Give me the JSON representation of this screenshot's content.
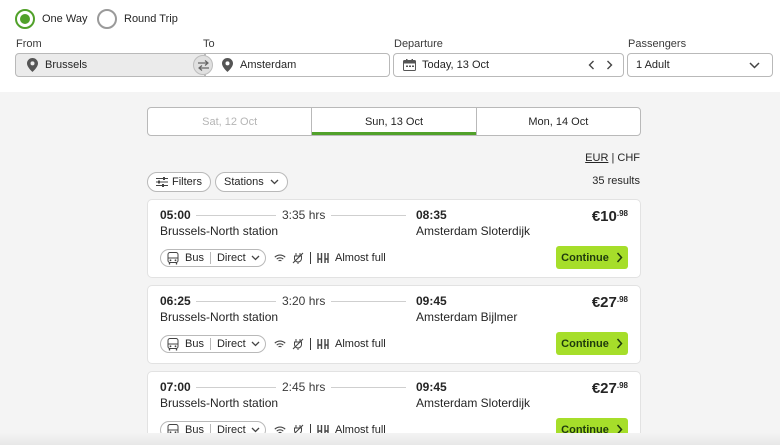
{
  "trip_type": {
    "one_way": "One Way",
    "round_trip": "Round Trip"
  },
  "search": {
    "from_label": "From",
    "from_value": "Brussels",
    "to_label": "To",
    "to_value": "Amsterdam",
    "departure_label": "Departure",
    "departure_value": "Today, 13 Oct",
    "passengers_label": "Passengers",
    "passengers_value": "1 Adult"
  },
  "dates": [
    "Sat, 12 Oct",
    "Sun, 13 Oct",
    "Mon, 14 Oct"
  ],
  "selected_date_index": 1,
  "currency": {
    "eur": "EUR",
    "separator": "|",
    "chf": "CHF"
  },
  "filters": {
    "filters_label": "Filters",
    "stations_label": "Stations"
  },
  "results_count": "35 results",
  "connections": [
    {
      "dep_time": "05:00",
      "duration": "3:35 hrs",
      "arr_time": "08:35",
      "from_station": "Brussels-North station",
      "to_station": "Amsterdam Sloterdijk",
      "price_main": "€10",
      "price_cents": ".98",
      "mode": "Bus",
      "route": "Direct",
      "capacity": "Almost full",
      "cta": "Continue"
    },
    {
      "dep_time": "06:25",
      "duration": "3:20 hrs",
      "arr_time": "09:45",
      "from_station": "Brussels-North station",
      "to_station": "Amsterdam Bijlmer",
      "price_main": "€27",
      "price_cents": ".98",
      "mode": "Bus",
      "route": "Direct",
      "capacity": "Almost full",
      "cta": "Continue"
    },
    {
      "dep_time": "07:00",
      "duration": "2:45 hrs",
      "arr_time": "09:45",
      "from_station": "Brussels-North station",
      "to_station": "Amsterdam Sloterdijk",
      "price_main": "€27",
      "price_cents": ".98",
      "mode": "Bus",
      "route": "Direct",
      "capacity": "Almost full",
      "cta": "Continue"
    }
  ],
  "colors": {
    "accent_green": "#51a12a",
    "cta_green": "#a6de2a"
  },
  "icons": [
    "radio-checked-icon",
    "radio-unchecked-icon",
    "location-pin-icon",
    "swap-icon",
    "calendar-icon",
    "chevron-left-icon",
    "chevron-right-icon",
    "chevron-down-icon",
    "filter-sliders-icon",
    "bus-icon",
    "wifi-icon",
    "no-power-icon",
    "seats-icon"
  ]
}
